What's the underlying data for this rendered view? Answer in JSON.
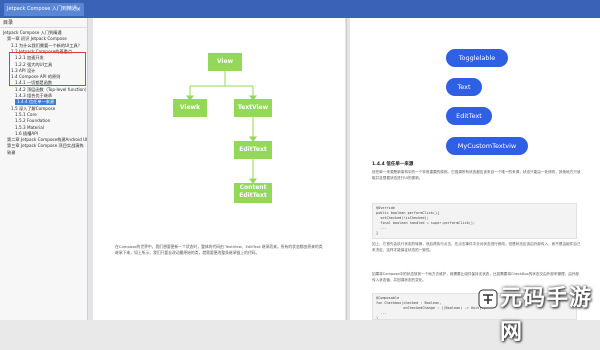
{
  "tab": {
    "title": "Jetpack Compose 入门到精通",
    "close": "×"
  },
  "sidebar": {
    "header": "目录",
    "items": [
      {
        "label": "Jetpack Compose 入门到精通",
        "indent": 0
      },
      {
        "label": "第一章 初识 Jetpack Compose",
        "indent": 1
      },
      {
        "label": "1.1 为什么我们需要一个新的UI工具？",
        "indent": 2
      },
      {
        "label": "1.2 Jetpack Compose的着重点",
        "indent": 2
      },
      {
        "label": "1.2.1 加速开发",
        "indent": 3
      },
      {
        "label": "1.2.2 强大的UI工具",
        "indent": 3
      },
      {
        "label": "1.3 API 设计",
        "indent": 2
      },
      {
        "label": "1.4 Compose API 的原则",
        "indent": 2
      },
      {
        "label": "1.4.1 一切都是函数",
        "indent": 3
      },
      {
        "label": "1.4.2 顶层函数（Top-level function）",
        "indent": 3
      },
      {
        "label": "1.4.3 组合优于继承",
        "indent": 3
      },
      {
        "label": "1.4.4 信任单一来源",
        "indent": 3,
        "selected": true
      },
      {
        "label": "1.5 深入了解Compose",
        "indent": 2
      },
      {
        "label": "1.5.1 Core",
        "indent": 3
      },
      {
        "label": "1.5.2 Foundation",
        "indent": 3
      },
      {
        "label": "1.5.3 Material",
        "indent": 3
      },
      {
        "label": "1.6 插槽API",
        "indent": 3
      },
      {
        "label": "第二章 Jetpack Compose构建Android UI",
        "indent": 1
      },
      {
        "label": "第三章 Jetpack Compose 项目实战演练",
        "indent": 1
      },
      {
        "label": "致谢",
        "indent": 1
      }
    ]
  },
  "diagram": {
    "nodes": [
      "View",
      "Viewk",
      "TextView",
      "EditText",
      "Content\nEditText"
    ]
  },
  "left_paragraph": "在Compose的世界中，我们想要更新一个状态时，整体的代码由 TextView、EditText 继承而来。所有的状态都由原来的类继承下来，如上所示，我们只要去改动最原始的类，就需要更改整条继承链上的代码。",
  "right_pills": [
    "Togglelable",
    "Text",
    "EditText",
    "MyCustomTextviw"
  ],
  "section": {
    "title": "1.4.4 信任单一来源",
    "para1": "信任单一来源是新架构中的一个非常重要的原则。它强调所有状态都应该来自一个唯一的来源，状态只能由一处修改，其他地方只读取并且根据状态进行UI的更新。",
    "code1": "@Override\npublic boolean performClick(){\n  setChecked(!isChecked);\n  final boolean handled = super.performClick();\n  ...\n}",
    "para2": "如上，它首先会执行状态的转换，然后再执行点击，在点击事件中去对状态进行修改。但是状态应该由外部传入，而不是由组件自己来决定，这样才能保证状态的一致性。",
    "para3": "如果将Compose中的状态放到一个地方去维护，就需要让组件保持无状态，比如需要将CheckBox的状态交由外部来管理，由外部传入状态值，并回调状态的变化。",
    "code2": "@Composable\nfun Checkbox(checked : Boolean,\n             onCheckedChange : ((Boolean) -> Unit)?,\n  ...\n)"
  },
  "watermark": {
    "text": "元码手游网"
  },
  "colors": {
    "tabbar": "#3a63b8",
    "node_green": "#93d856",
    "pill_blue": "#2f5fe2",
    "selection": "#3c7be0",
    "highlight_box": "#e23b3b"
  }
}
